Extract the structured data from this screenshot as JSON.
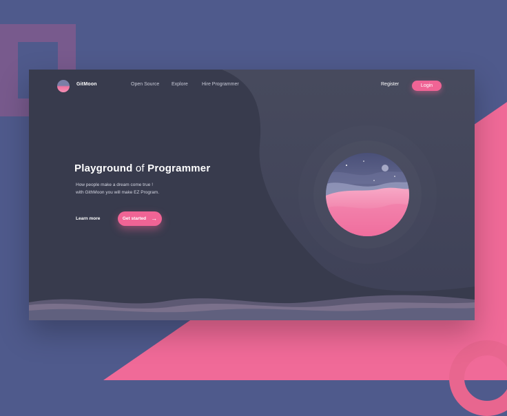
{
  "brand": {
    "name": "GitMoon",
    "logo_icon": "moon-planet-logo-icon"
  },
  "nav": {
    "links": [
      "Open Source",
      "Explore",
      "Hire Programmer"
    ],
    "register_label": "Register",
    "login_label": "Login"
  },
  "hero": {
    "title_bold_1": "Playground",
    "title_connector": " of ",
    "title_bold_2": "Programmer",
    "subtitle_line_1": "How people make a dream come true !",
    "subtitle_line_2": "with GithMoon you will make EZ Program.",
    "learn_more_label": "Learn more",
    "get_started_label": "Get started",
    "arrow_icon": "arrow-right-icon"
  },
  "colors": {
    "background": "#4f5a8c",
    "window": "#383b4d",
    "accent_pink": "#f06495",
    "decor_purple": "#7a5b8d"
  }
}
